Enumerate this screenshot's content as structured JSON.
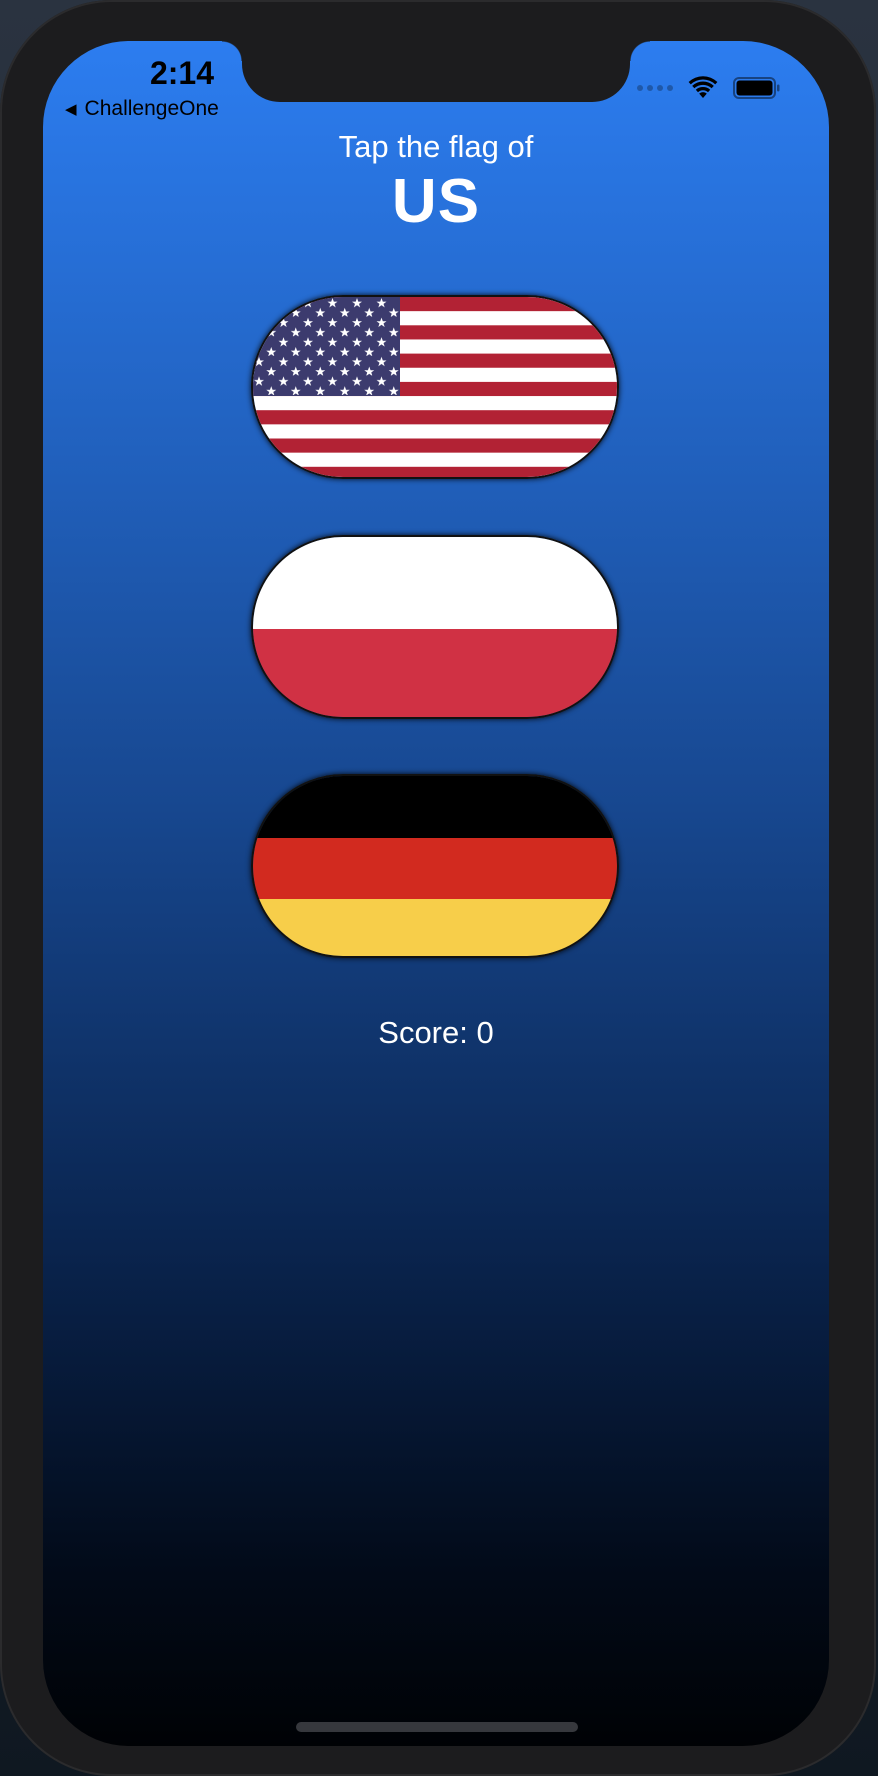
{
  "status_bar": {
    "time": "2:14",
    "back_label": "ChallengeOne",
    "icons": [
      "back-arrow-icon",
      "cellular-signal-icon",
      "wifi-icon",
      "battery-icon"
    ]
  },
  "prompt": {
    "text": "Tap the flag of",
    "country": "US"
  },
  "flags": [
    {
      "country": "US",
      "icon": "us-flag-icon"
    },
    {
      "country": "Poland",
      "icon": "poland-flag-icon"
    },
    {
      "country": "Germany",
      "icon": "germany-flag-icon"
    }
  ],
  "score_text": "Score: 0",
  "colors": {
    "gradient_top": "#2c7df0",
    "gradient_bottom": "#000205",
    "us_red": "#b22234",
    "us_blue": "#3c3b6e",
    "poland_red": "#d03144",
    "germany_black": "#000000",
    "germany_red": "#d22a1f",
    "germany_gold": "#f7ce4a"
  }
}
